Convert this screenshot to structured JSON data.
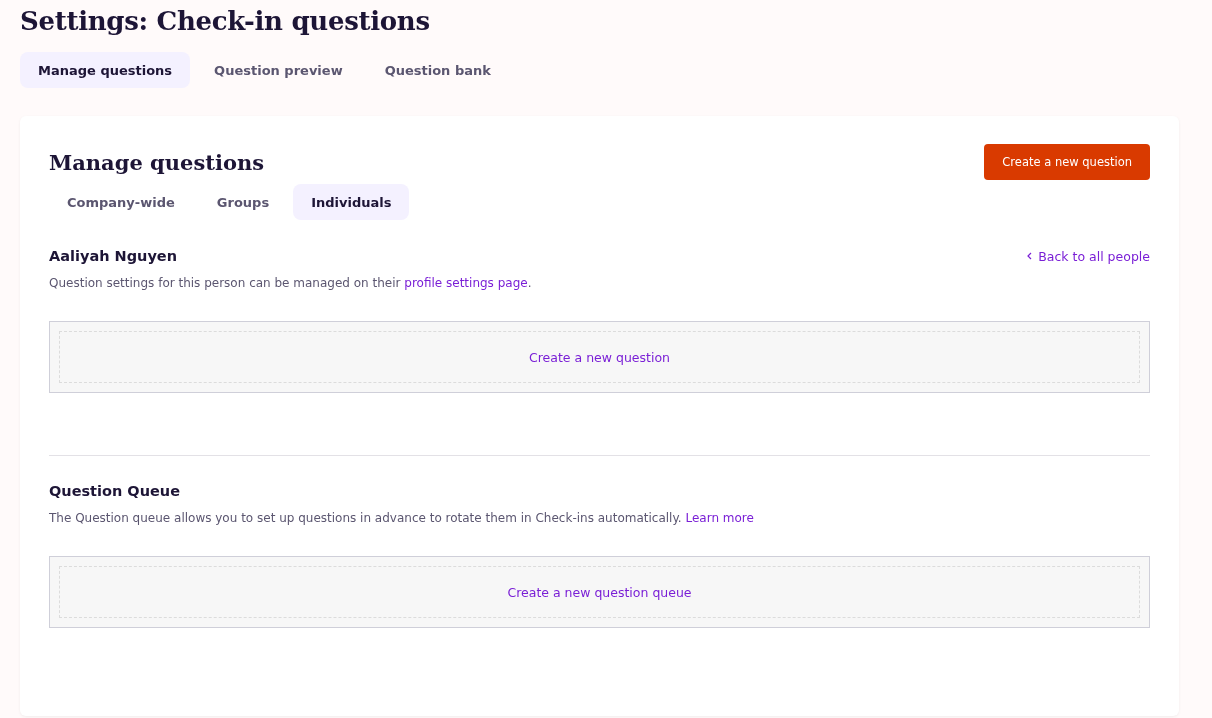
{
  "page_title": "Settings: Check-in questions",
  "tabs": [
    {
      "label": "Manage questions",
      "selected": true
    },
    {
      "label": "Question preview",
      "selected": false
    },
    {
      "label": "Question bank",
      "selected": false
    }
  ],
  "card": {
    "title": "Manage questions",
    "primary_button": "Create a new question",
    "subtabs": [
      {
        "label": "Company-wide",
        "selected": false
      },
      {
        "label": "Groups",
        "selected": false
      },
      {
        "label": "Individuals",
        "selected": true
      }
    ],
    "person": {
      "name": "Aaliyah Nguyen",
      "back_link": "Back to all people",
      "description": "Question settings for this person can be managed on their ",
      "description_link": "profile settings page",
      "description_end": ".",
      "empty_action": "Create a new question"
    },
    "queue": {
      "title": "Question Queue",
      "description": "The Question queue allows you to set up questions in advance to rotate them in Check-ins automatically. ",
      "description_link": "Learn more",
      "empty_action": "Create a new question queue"
    }
  }
}
